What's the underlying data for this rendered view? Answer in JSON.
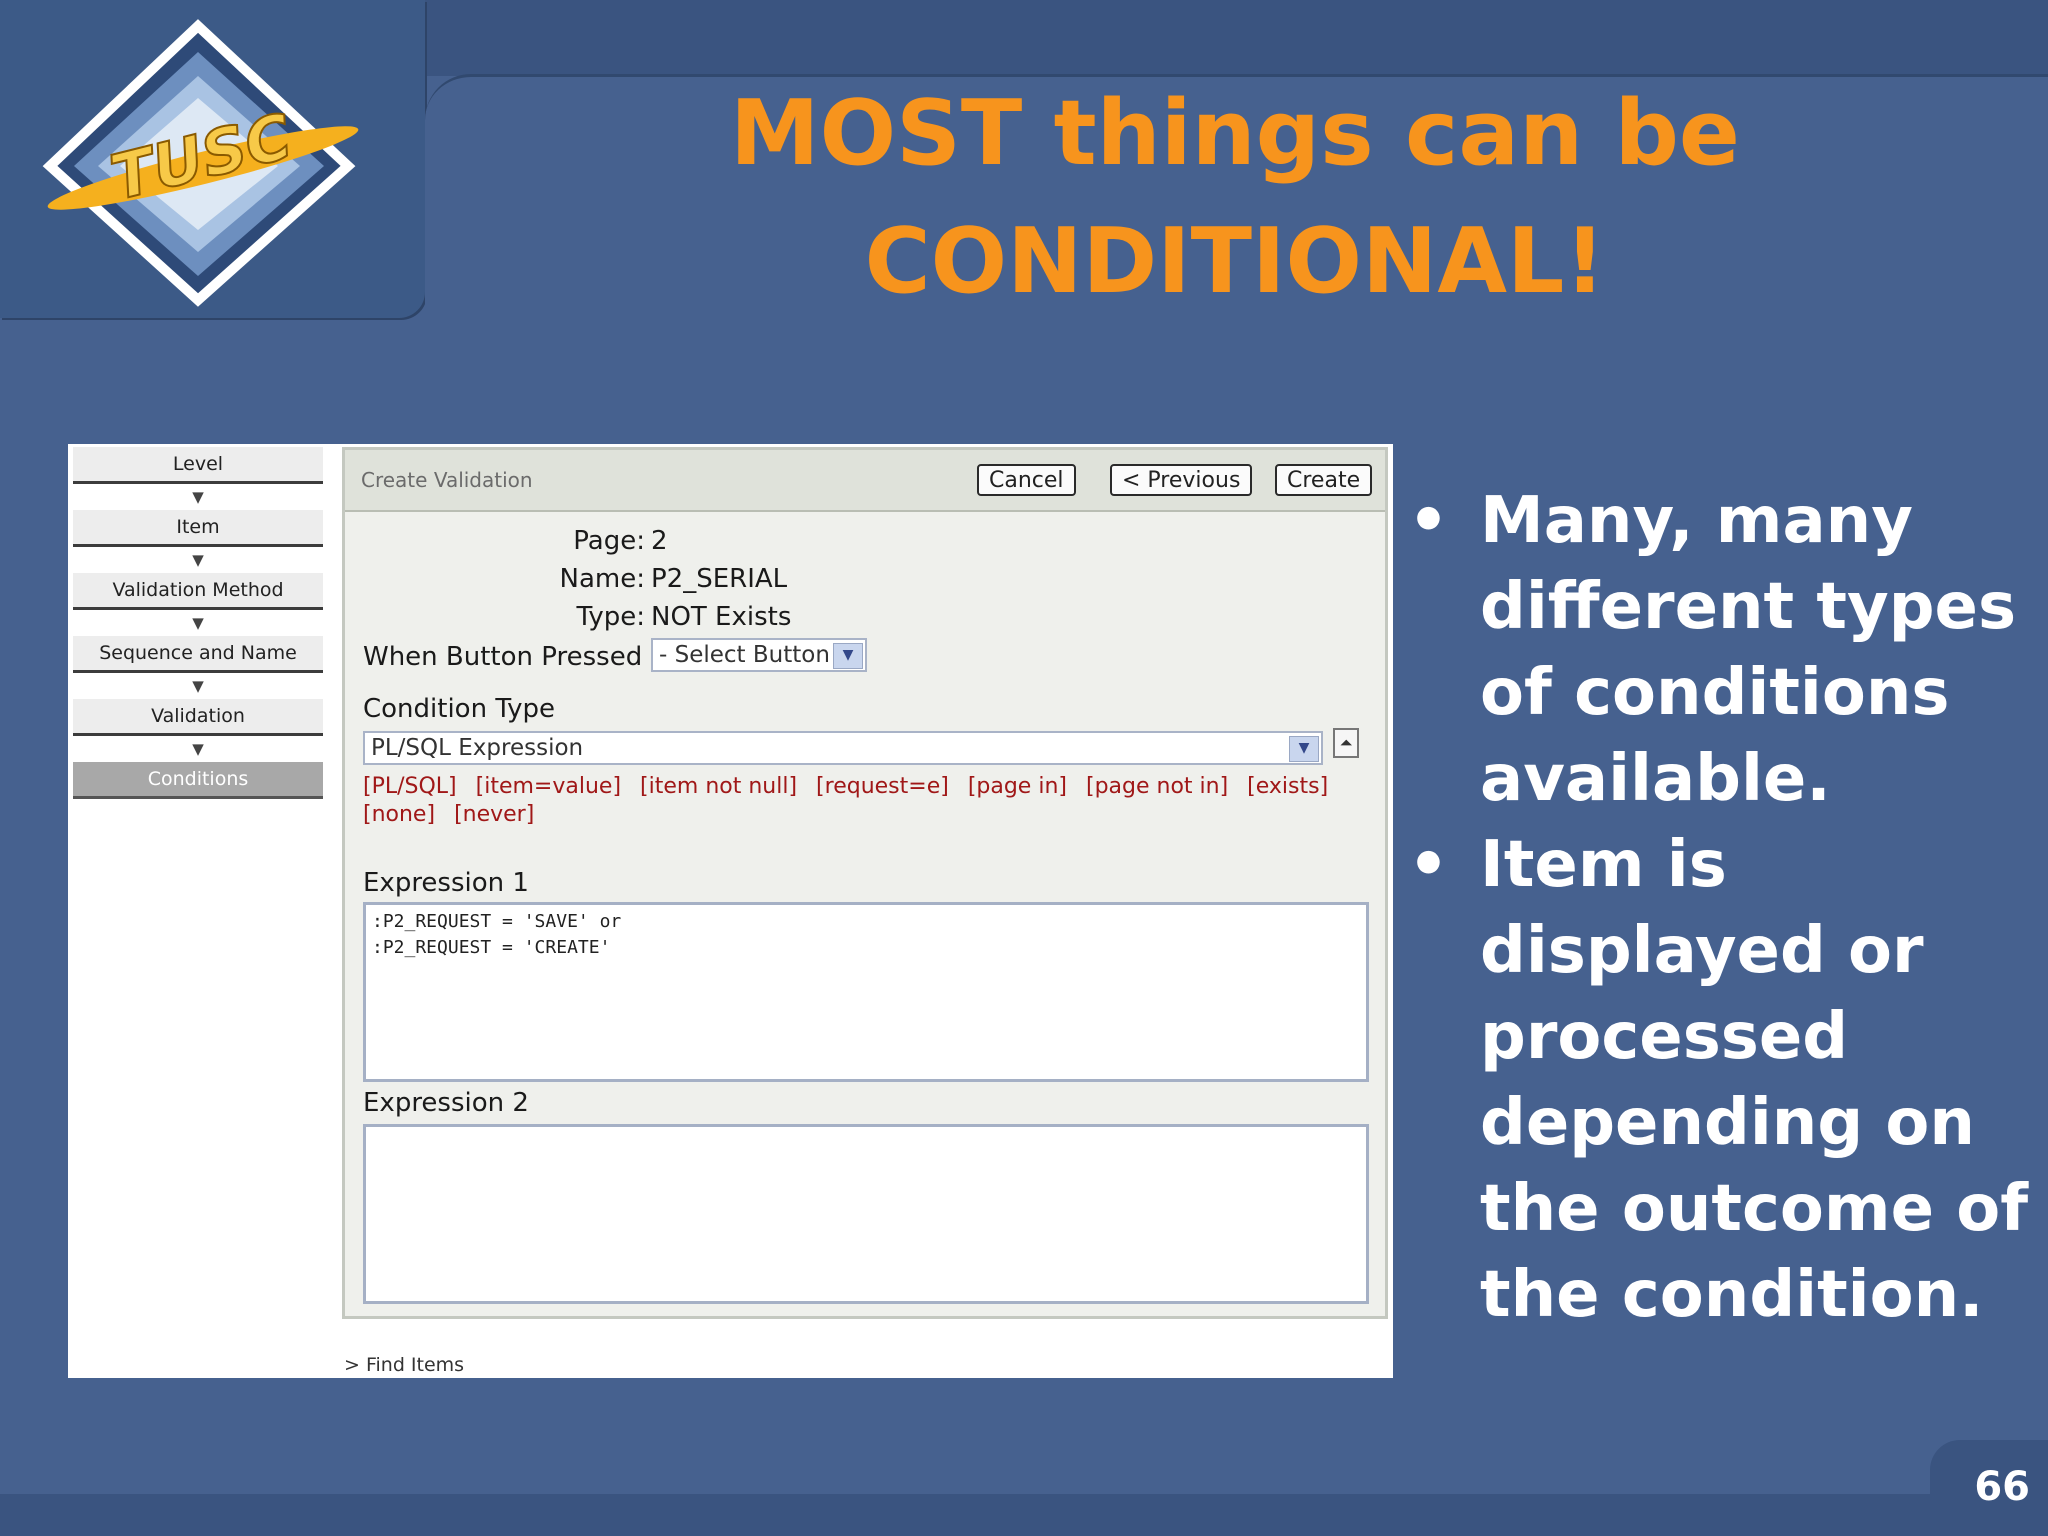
{
  "slide": {
    "title_line1": "MOST things can be",
    "title_line2": "CONDITIONAL!",
    "logo_text": "TUSC",
    "page_number": "66",
    "bullets": [
      "Many, many different types of conditions available.",
      "Item is displayed or processed depending on the outcome of the condition."
    ],
    "bullet_symbol": "•"
  },
  "wizard": {
    "steps": [
      "Level",
      "Item",
      "Validation Method",
      "Sequence and Name",
      "Validation",
      "Conditions"
    ],
    "active": "Conditions"
  },
  "panel": {
    "title": "Create Validation",
    "buttons": {
      "cancel": "Cancel",
      "previous": "< Previous",
      "create": "Create"
    },
    "info": {
      "page_label": "Page:",
      "page_value": "2",
      "name_label": "Name:",
      "name_value": "P2_SERIAL",
      "type_label": "Type:",
      "type_value": "NOT Exists"
    },
    "when_button_pressed": {
      "label": "When Button Pressed",
      "value": "- Select Button -"
    },
    "condition_type": {
      "label": "Condition Type",
      "value": "PL/SQL Expression",
      "shortcuts": [
        "[PL/SQL]",
        "[item=value]",
        "[item not null]",
        "[request=e]",
        "[page in]",
        "[page not in]",
        "[exists]",
        "[none]",
        "[never]"
      ]
    },
    "expression1": {
      "label": "Expression 1",
      "value": ":P2_REQUEST = 'SAVE' or\n:P2_REQUEST = 'CREATE'"
    },
    "expression2": {
      "label": "Expression 2",
      "value": ""
    },
    "find_items": "> Find Items"
  },
  "colors": {
    "title": "#f7941d",
    "background": "#46618f",
    "link_red": "#a01818"
  }
}
